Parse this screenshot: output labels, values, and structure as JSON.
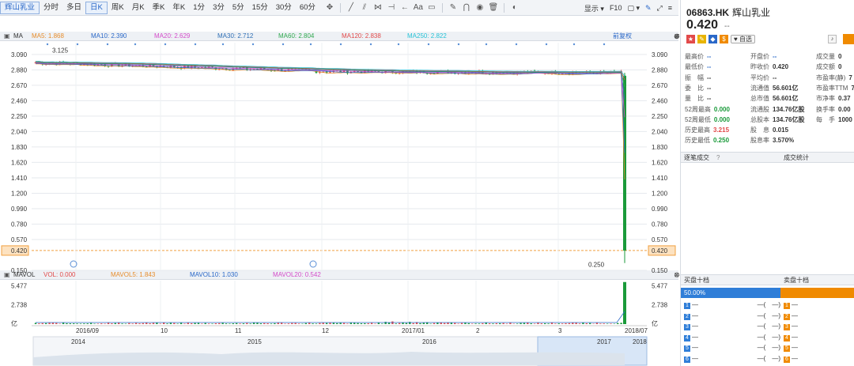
{
  "toolbar": {
    "stock_tab": "辉山乳业",
    "periods": [
      "分时",
      "多日",
      "日K",
      "周K",
      "月K",
      "季K",
      "年K",
      "1分",
      "3分",
      "5分",
      "15分",
      "30分",
      "60分"
    ],
    "display_label": "显示",
    "f10_label": "F10",
    "tool_glyph": "Aa"
  },
  "ma_bar": {
    "label": "MA",
    "items": [
      {
        "text": "MA5: 1.868",
        "color": "#e78d2c"
      },
      {
        "text": "MA10: 2.390",
        "color": "#2a68c8"
      },
      {
        "text": "MA20: 2.629",
        "color": "#d44bc9"
      },
      {
        "text": "MA30: 2.712",
        "color": "#2f6fb5"
      },
      {
        "text": "MA60: 2.804",
        "color": "#2fa84e"
      },
      {
        "text": "MA120: 2.838",
        "color": "#e24a4a"
      },
      {
        "text": "MA250: 2.822",
        "color": "#26c2d6"
      }
    ],
    "adjust_label": "前复权"
  },
  "vol_bar": {
    "label": "MAVOL",
    "items": [
      {
        "text": "VOL: 0.000",
        "color": "#e24a4a"
      },
      {
        "text": "MAVOL5: 1.843",
        "color": "#e78d2c"
      },
      {
        "text": "MAVOL10: 1.030",
        "color": "#2a68c8"
      },
      {
        "text": "MAVOL20: 0.542",
        "color": "#d44bc9"
      }
    ]
  },
  "chart_data": [
    {
      "type": "candlestick",
      "y_ticks": [
        "3.090",
        "2.880",
        "2.670",
        "2.460",
        "2.250",
        "2.040",
        "1.830",
        "1.620",
        "1.410",
        "1.200",
        "0.990",
        "0.780",
        "0.570",
        "0.420",
        "0.150"
      ],
      "ylim": [
        0.15,
        3.25
      ],
      "current_price": "0.420",
      "annotations": {
        "high_label": "3.125",
        "low_label": "0.250"
      },
      "series": [
        {
          "name": "MA5",
          "color": "#e78d2c"
        },
        {
          "name": "MA10",
          "color": "#2a68c8"
        },
        {
          "name": "MA20",
          "color": "#d44bc9"
        },
        {
          "name": "MA30",
          "color": "#2f6fb5"
        },
        {
          "name": "MA60",
          "color": "#2fa84e"
        },
        {
          "name": "MA120",
          "color": "#e24a4a"
        },
        {
          "name": "MA250",
          "color": "#26c2d6"
        }
      ],
      "trend": {
        "start": 2.98,
        "mid": 2.86,
        "end_before_crash": 2.84,
        "crash_low": 0.25,
        "last": 0.42
      }
    },
    {
      "type": "bar",
      "y_ticks": [
        "5.477",
        "2.738"
      ],
      "unit": "亿",
      "ylim": [
        0,
        6.2
      ]
    }
  ],
  "x_axis": {
    "labels": [
      "2016/09",
      "10",
      "11",
      "12",
      "2017/01",
      "2",
      "3",
      "2018/07"
    ]
  },
  "navigator": {
    "years": [
      "2014",
      "2015",
      "2016",
      "2017",
      "2018"
    ]
  },
  "quote": {
    "code": "06863.HK",
    "name": "辉山乳业",
    "price": "0.420",
    "change": "--",
    "watch_label": "自选",
    "badges": [
      {
        "text": "★",
        "color": "#e24a4a"
      },
      {
        "text": "✎",
        "color": "#e8b400"
      },
      {
        "text": "◆",
        "color": "#2a68c8"
      },
      {
        "text": "$",
        "color": "#f08a00"
      }
    ]
  },
  "stats": [
    {
      "k": "最高价",
      "v": "--",
      "c": "#2a68c8"
    },
    {
      "k": "开盘价",
      "v": "--",
      "c": "#2a68c8"
    },
    {
      "k": "成交量",
      "v": "0",
      "c": "#333"
    },
    {
      "k": "最低价",
      "v": "--",
      "c": "#2a68c8"
    },
    {
      "k": "昨收价",
      "v": "0.420",
      "c": "#333"
    },
    {
      "k": "成交额",
      "v": "0",
      "c": "#333"
    },
    {
      "k": "振　幅",
      "v": "--",
      "c": "#333"
    },
    {
      "k": "平均价",
      "v": "--",
      "c": "#333"
    },
    {
      "k": "市盈率(静)",
      "v": "7",
      "c": "#333"
    },
    {
      "k": "委　比",
      "v": "--",
      "c": "#333"
    },
    {
      "k": "流通值",
      "v": "56.601亿",
      "c": "#333"
    },
    {
      "k": "市盈率TTM",
      "v": "7",
      "c": "#333"
    },
    {
      "k": "量　比",
      "v": "--",
      "c": "#333"
    },
    {
      "k": "总市值",
      "v": "56.601亿",
      "c": "#333"
    },
    {
      "k": "市净率",
      "v": "0.37",
      "c": "#333"
    },
    {
      "k": "52周最高",
      "v": "0.000",
      "c": "#1a9a3a"
    },
    {
      "k": "流通股",
      "v": "134.76亿股",
      "c": "#333"
    },
    {
      "k": "换手率",
      "v": "0.00",
      "c": "#333"
    },
    {
      "k": "52周最低",
      "v": "0.000",
      "c": "#1a9a3a"
    },
    {
      "k": "总股本",
      "v": "134.76亿股",
      "c": "#333"
    },
    {
      "k": "每　手",
      "v": "1000",
      "c": "#333"
    },
    {
      "k": "历史最高",
      "v": "3.215",
      "c": "#e24a4a"
    },
    {
      "k": "股　息",
      "v": "0.015",
      "c": "#333"
    },
    {
      "k": "",
      "v": "",
      "c": "#333"
    },
    {
      "k": "历史最低",
      "v": "0.250",
      "c": "#1a9a3a"
    },
    {
      "k": "股息率",
      "v": "3.570%",
      "c": "#333"
    },
    {
      "k": "",
      "v": "",
      "c": "#333"
    }
  ],
  "sections": {
    "trades_label": "逐笔成交",
    "stats_label": "成交统计",
    "buy_label": "买盘十档",
    "sell_label": "卖盘十档",
    "buy_ratio": "50.00%"
  },
  "order_book": {
    "rows": [
      {
        "idx": "1",
        "price": "—",
        "qty": "—(　—)"
      },
      {
        "idx": "2",
        "price": "—",
        "qty": "—(　—)"
      },
      {
        "idx": "3",
        "price": "—",
        "qty": "—(　—)"
      },
      {
        "idx": "4",
        "price": "—",
        "qty": "—(　—)"
      },
      {
        "idx": "5",
        "price": "—",
        "qty": "—(　—)"
      },
      {
        "idx": "6",
        "price": "—",
        "qty": "—(　—)"
      }
    ]
  }
}
